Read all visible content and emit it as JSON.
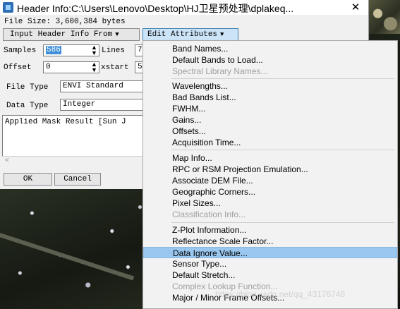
{
  "window": {
    "title": "Header Info:C:\\Users\\Lenovo\\Desktop\\HJ卫星预处理\\dplakeq...",
    "close_glyph": "✕"
  },
  "file_size": "File Size: 3,600,384 bytes",
  "toolbar": {
    "input_header_label": "Input Header Info From",
    "edit_attributes_label": "Edit Attributes"
  },
  "fields": {
    "samples_label": "Samples",
    "samples_value": "586",
    "lines_label": "Lines",
    "lines_value": "7",
    "offset_label": "Offset",
    "offset_value": "0",
    "xstart_label": "xstart",
    "xstart_value": "5",
    "file_type_label": "File Type",
    "file_type_value": "ENVI Standard",
    "data_type_label": "Data Type",
    "data_type_value": "Integer"
  },
  "description": "Applied Mask Result [Sun J",
  "buttons": {
    "ok": "OK",
    "cancel": "Cancel"
  },
  "menu": {
    "items": [
      {
        "label": "Band Names...",
        "enabled": true
      },
      {
        "label": "Default Bands to Load...",
        "enabled": true
      },
      {
        "label": "Spectral Library Names...",
        "enabled": false
      },
      {
        "label": "Wavelengths...",
        "enabled": true
      },
      {
        "label": "Bad Bands List...",
        "enabled": true
      },
      {
        "label": "FWHM...",
        "enabled": true
      },
      {
        "label": "Gains...",
        "enabled": true
      },
      {
        "label": "Offsets...",
        "enabled": true
      },
      {
        "label": "Acquisition Time...",
        "enabled": true
      },
      {
        "label": "Map Info...",
        "enabled": true
      },
      {
        "label": "RPC or RSM Projection Emulation...",
        "enabled": true
      },
      {
        "label": "Associate DEM File...",
        "enabled": true
      },
      {
        "label": "Geographic Corners...",
        "enabled": true
      },
      {
        "label": "Pixel Sizes...",
        "enabled": true
      },
      {
        "label": "Classification Info...",
        "enabled": false
      },
      {
        "label": "Z-Plot Information...",
        "enabled": true
      },
      {
        "label": "Reflectance Scale Factor...",
        "enabled": true
      },
      {
        "label": "Data Ignore Value...",
        "enabled": true,
        "highlighted": true
      },
      {
        "label": "Sensor Type...",
        "enabled": true
      },
      {
        "label": "Default Stretch...",
        "enabled": true
      },
      {
        "label": "Complex Lookup Function...",
        "enabled": false
      },
      {
        "label": "Major / Minor Frame Offsets...",
        "enabled": true
      }
    ]
  },
  "watermark": "https://blog.csdn.net/qq_43176746",
  "colors": {
    "highlight": "#9ac7ef",
    "disabled_text": "#a0a0a0"
  }
}
